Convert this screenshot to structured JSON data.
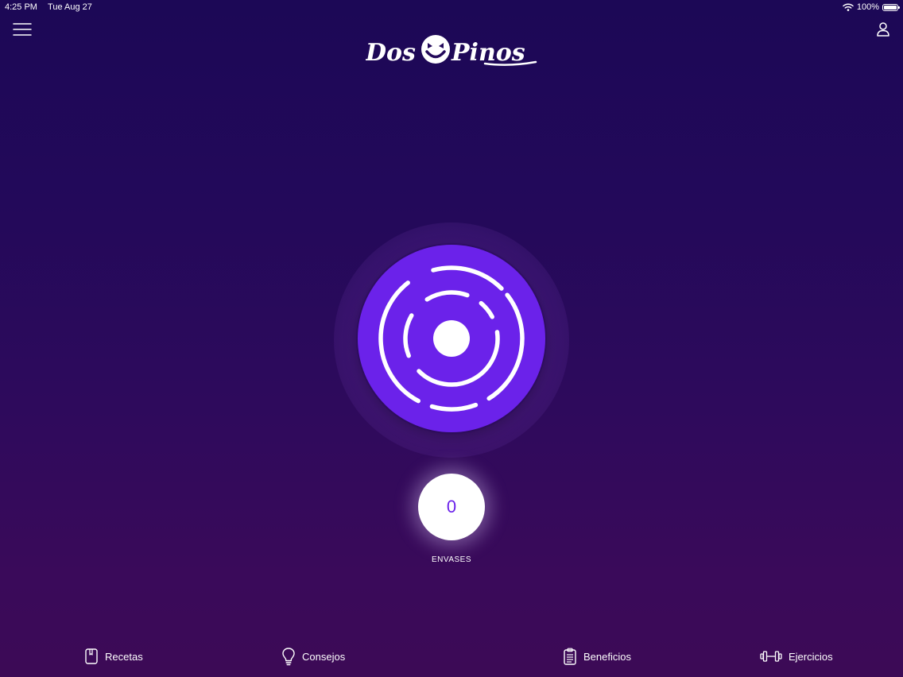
{
  "status_bar": {
    "time": "4:25 PM",
    "date": "Tue Aug 27",
    "battery": "100%",
    "battery_level": 1.0
  },
  "header": {
    "menu_icon": "hamburger-menu-icon",
    "user_icon": "user-icon",
    "logo_text_left": "Dos",
    "logo_text_right": "Pinos"
  },
  "scanner": {
    "icon": "scan-rings-icon",
    "color": "#6b22ea"
  },
  "counter": {
    "value": "0",
    "label": "ENVASES"
  },
  "bottom_nav": {
    "items": [
      {
        "label": "Recetas",
        "icon": "recipe-book-icon"
      },
      {
        "label": "Consejos",
        "icon": "lightbulb-icon"
      },
      {
        "label": "Beneficios",
        "icon": "clipboard-icon"
      },
      {
        "label": "Ejercicios",
        "icon": "dumbbell-icon"
      }
    ]
  },
  "colors": {
    "background_top": "#1c0856",
    "background_bottom": "#3c0a56",
    "accent": "#6b22ea",
    "text": "#ffffff"
  }
}
